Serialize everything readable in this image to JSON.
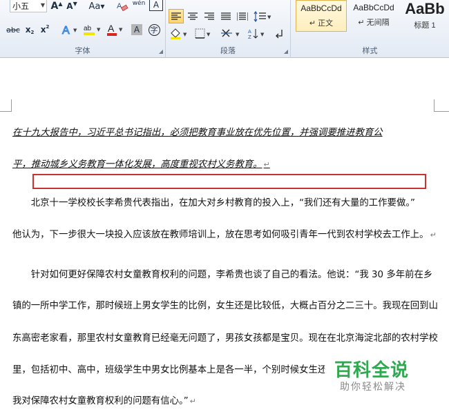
{
  "ribbon": {
    "font_group": {
      "label": "字体",
      "font_size": "小五",
      "grow_label": "A",
      "shrink_label": "A",
      "case_label": "Aa",
      "clear_label": "A",
      "phonetic_label": "wén",
      "border_char": "A",
      "sub_label": "x",
      "sup_label": "x",
      "strike_label": "abc",
      "highlight_label": "ab",
      "color_label": "A",
      "shading_label": "A",
      "enclose_label": "字"
    },
    "paragraph_group": {
      "label": "段落"
    },
    "styles_group": {
      "label": "样式",
      "styles": [
        {
          "sample": "AaBbCcDd",
          "name": "正文",
          "prefix": "↵"
        },
        {
          "sample": "AaBbCcDd",
          "name": "无间隔",
          "prefix": "↵"
        },
        {
          "sample": "AaBb",
          "name": "标题 1",
          "prefix": ""
        }
      ]
    },
    "colors": {
      "highlight": "#f2e500",
      "font_color": "#d6261f",
      "accent": "#2b579a"
    }
  },
  "document": {
    "lines": [
      {
        "text": "在十九大报告中，习近平总书记指出，必须把教育事业放在优先位置，并强调要推进教育公",
        "style": "underline"
      },
      {
        "text": "平，推动城乡义务教育一体化发展，高度重视农村义务教育。",
        "style": "underline",
        "mark": "↵"
      },
      {
        "text": "　　北京十一学校校长李希贵代表指出，在加大对乡村教育的投入上，“我们还有大量的工作要做。”",
        "style": "normal"
      },
      {
        "text": "他认为，下一步很大一块投入应该放在教师培训上，放在思考如何吸引青年一代到农村学校去工作上。",
        "style": "normal",
        "mark": "↵"
      },
      {
        "text": "　　针对如何更好保障农村女童教育权利的问题，李希贵也谈了自己的看法。他说：“我 30 多年前在乡",
        "style": "normal"
      },
      {
        "text": "镇的一所中学工作，那时候班上男女学生的比例，女生还是比较低，大概占百分之二三十。我现在回到山",
        "style": "normal"
      },
      {
        "text": "东高密老家看，那里农村女童教育已经毫无问题了，男孩女孩都是宝贝。现在在北京海淀北部的农村学校",
        "style": "normal"
      },
      {
        "text": "里，包括初中、高中，班级学生中男女比例基本上是各一半，个别时候女生还",
        "style": "normal"
      },
      {
        "text": "我对保障农村女童教育权利的问题有信心。”",
        "style": "normal",
        "mark": "↵"
      }
    ]
  },
  "watermark": {
    "title": "百科全说",
    "subtitle": "助你轻松解决"
  }
}
